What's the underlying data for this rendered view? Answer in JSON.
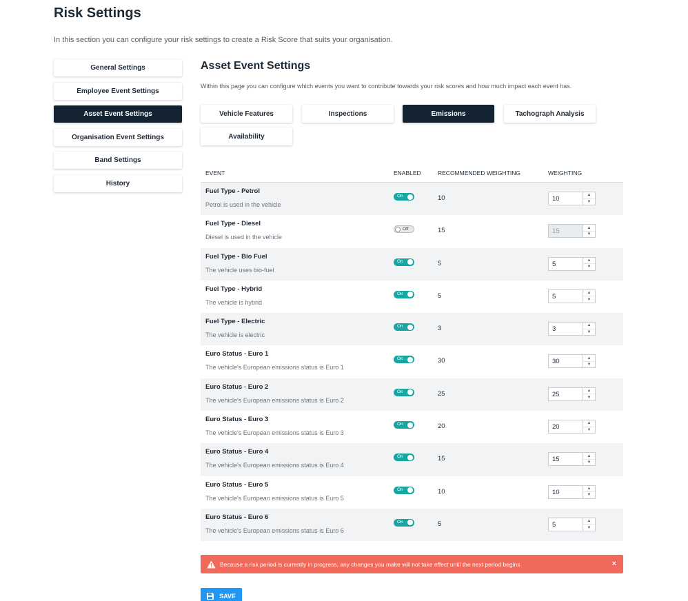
{
  "page": {
    "title": "Risk Settings",
    "description": "In this section you can configure your risk settings to create a Risk Score that suits your organisation."
  },
  "sidebar": {
    "items": [
      {
        "label": "General Settings",
        "active": false
      },
      {
        "label": "Employee Event Settings",
        "active": false
      },
      {
        "label": "Asset Event Settings",
        "active": true
      },
      {
        "label": "Organisation Event Settings",
        "active": false
      },
      {
        "label": "Band Settings",
        "active": false
      },
      {
        "label": "History",
        "active": false
      }
    ]
  },
  "section": {
    "title": "Asset Event Settings",
    "description": "Within this page you can configure which events you want to contribute towards your risk scores and how much impact each event has."
  },
  "tabs": [
    {
      "label": "Vehicle Features",
      "active": false
    },
    {
      "label": "Inspections",
      "active": false
    },
    {
      "label": "Emissions",
      "active": true
    },
    {
      "label": "Tachograph Analysis",
      "active": false
    },
    {
      "label": "Availability",
      "active": false
    }
  ],
  "table": {
    "headers": {
      "event": "EVENT",
      "enabled": "ENABLED",
      "recommended": "RECOMMENDED WEIGHTING",
      "weighting": "WEIGHTING"
    },
    "on_label": "On",
    "off_label": "Off",
    "rows": [
      {
        "name": "Fuel Type - Petrol",
        "desc": "Petrol is used in the vehicle",
        "enabled": true,
        "recommended": "10",
        "weighting": "10"
      },
      {
        "name": "Fuel Type - Diesel",
        "desc": "Diesel is used in the vehicle",
        "enabled": false,
        "recommended": "15",
        "weighting": "15"
      },
      {
        "name": "Fuel Type - Bio Fuel",
        "desc": "The vehicle uses bio-fuel",
        "enabled": true,
        "recommended": "5",
        "weighting": "5"
      },
      {
        "name": "Fuel Type - Hybrid",
        "desc": "The vehicle is hybrid",
        "enabled": true,
        "recommended": "5",
        "weighting": "5"
      },
      {
        "name": "Fuel Type - Electric",
        "desc": "The vehicle is electric",
        "enabled": true,
        "recommended": "3",
        "weighting": "3"
      },
      {
        "name": "Euro Status - Euro 1",
        "desc": "The vehicle's European emissions status is Euro 1",
        "enabled": true,
        "recommended": "30",
        "weighting": "30"
      },
      {
        "name": "Euro Status - Euro 2",
        "desc": "The vehicle's European emissions status is Euro 2",
        "enabled": true,
        "recommended": "25",
        "weighting": "25"
      },
      {
        "name": "Euro Status - Euro 3",
        "desc": "The vehicle's European emissions status is Euro 3",
        "enabled": true,
        "recommended": "20",
        "weighting": "20"
      },
      {
        "name": "Euro Status - Euro 4",
        "desc": "The vehicle's European emissions status is Euro 4",
        "enabled": true,
        "recommended": "15",
        "weighting": "15"
      },
      {
        "name": "Euro Status - Euro 5",
        "desc": "The vehicle's European emissions status is Euro 5",
        "enabled": true,
        "recommended": "10",
        "weighting": "10"
      },
      {
        "name": "Euro Status - Euro 6",
        "desc": "The vehicle's European emissions status is Euro 6",
        "enabled": true,
        "recommended": "5",
        "weighting": "5"
      }
    ]
  },
  "alert": {
    "message": "Because a risk period is currently in progress, any changes you make will not take effect until the next period begins",
    "close": "×",
    "color": "#f0695a"
  },
  "save": {
    "label": "SAVE",
    "color": "#2196f3"
  },
  "colors": {
    "dark": "#132331",
    "toggle_on": "#17a6a1"
  }
}
